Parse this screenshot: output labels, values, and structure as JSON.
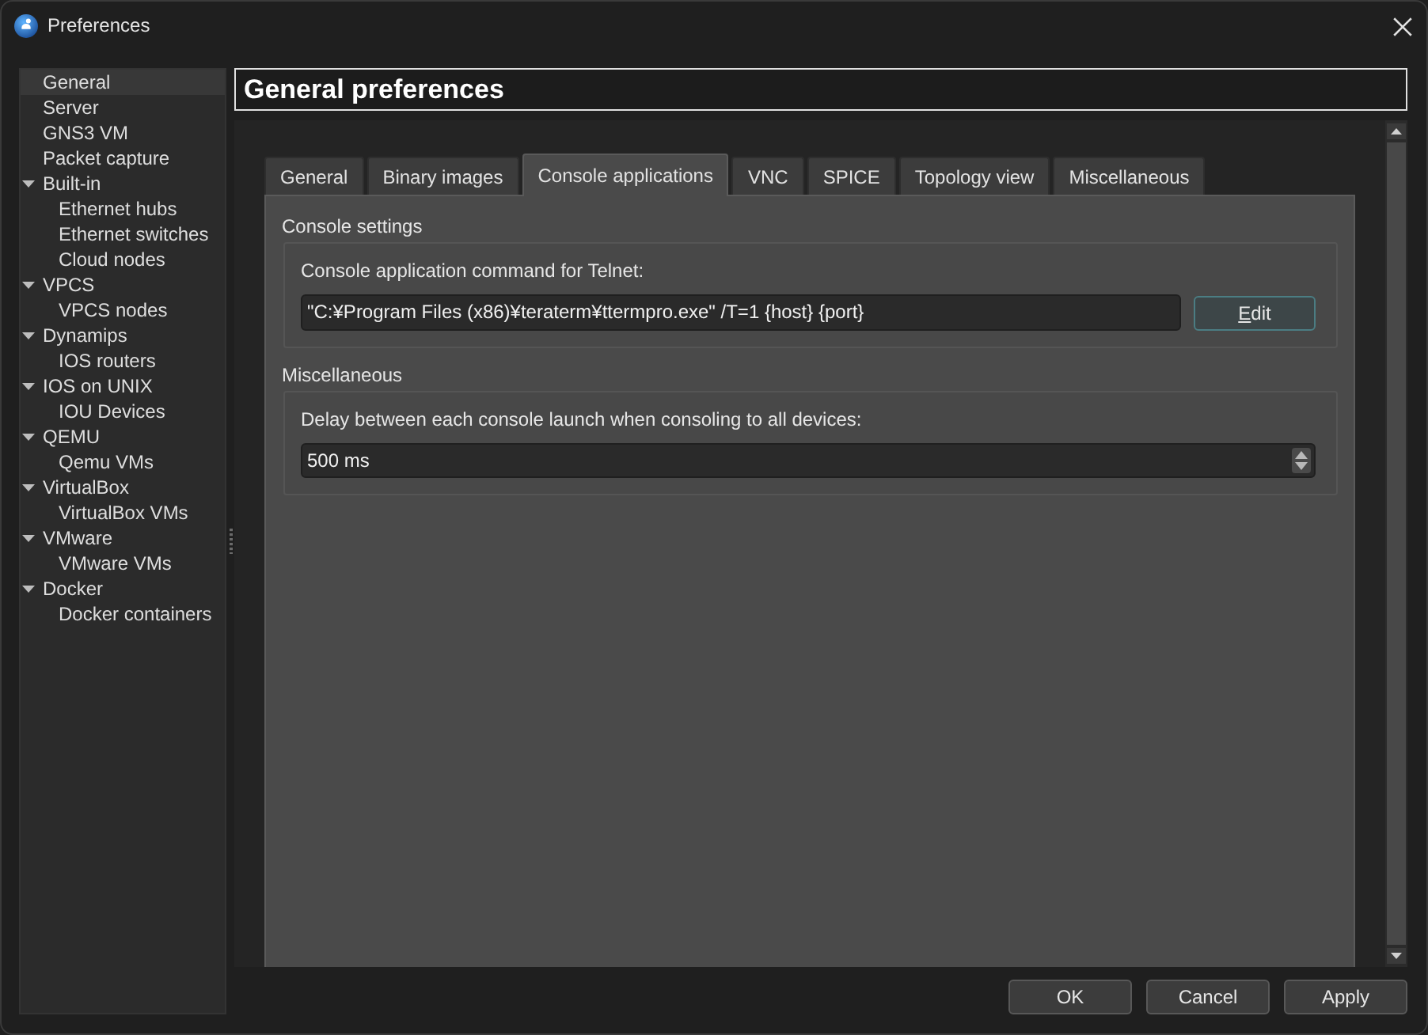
{
  "window": {
    "title": "Preferences"
  },
  "sidebar": {
    "items": [
      {
        "label": "General",
        "selected": true
      },
      {
        "label": "Server",
        "selected": false
      },
      {
        "label": "GNS3 VM",
        "selected": false
      },
      {
        "label": "Packet capture",
        "selected": false
      },
      {
        "label": "Built-in",
        "selected": false,
        "expanded": true,
        "children": [
          {
            "label": "Ethernet hubs",
            "selected": false
          },
          {
            "label": "Ethernet switches",
            "selected": false
          },
          {
            "label": "Cloud nodes",
            "selected": false
          }
        ]
      },
      {
        "label": "VPCS",
        "selected": false,
        "expanded": true,
        "children": [
          {
            "label": "VPCS nodes",
            "selected": false
          }
        ]
      },
      {
        "label": "Dynamips",
        "selected": false,
        "expanded": true,
        "children": [
          {
            "label": "IOS routers",
            "selected": false
          }
        ]
      },
      {
        "label": "IOS on UNIX",
        "selected": false,
        "expanded": true,
        "children": [
          {
            "label": "IOU Devices",
            "selected": false
          }
        ]
      },
      {
        "label": "QEMU",
        "selected": false,
        "expanded": true,
        "children": [
          {
            "label": "Qemu VMs",
            "selected": false
          }
        ]
      },
      {
        "label": "VirtualBox",
        "selected": false,
        "expanded": true,
        "children": [
          {
            "label": "VirtualBox VMs",
            "selected": false
          }
        ]
      },
      {
        "label": "VMware",
        "selected": false,
        "expanded": true,
        "children": [
          {
            "label": "VMware VMs",
            "selected": false
          }
        ]
      },
      {
        "label": "Docker",
        "selected": false,
        "expanded": true,
        "children": [
          {
            "label": "Docker containers",
            "selected": false
          }
        ]
      }
    ]
  },
  "header": {
    "title": "General preferences"
  },
  "tabs": [
    {
      "label": "General",
      "selected": false
    },
    {
      "label": "Binary images",
      "selected": false
    },
    {
      "label": "Console applications",
      "selected": true
    },
    {
      "label": "VNC",
      "selected": false
    },
    {
      "label": "SPICE",
      "selected": false
    },
    {
      "label": "Topology view",
      "selected": false
    },
    {
      "label": "Miscellaneous",
      "selected": false
    }
  ],
  "groups": [
    {
      "title": "Console settings",
      "fields": [
        {
          "kind": "command",
          "label": "Console application command for Telnet:",
          "value": "\"C:¥Program Files (x86)¥teraterm¥ttermpro.exe\" /T=1 {host} {port}",
          "button": "Edit"
        }
      ]
    },
    {
      "title": "Miscellaneous",
      "fields": [
        {
          "kind": "spinbox",
          "label": "Delay between each console launch when consoling to all devices:",
          "value": "500 ms"
        }
      ]
    }
  ],
  "buttons": [
    {
      "label": "OK"
    },
    {
      "label": "Cancel"
    },
    {
      "label": "Apply"
    }
  ]
}
